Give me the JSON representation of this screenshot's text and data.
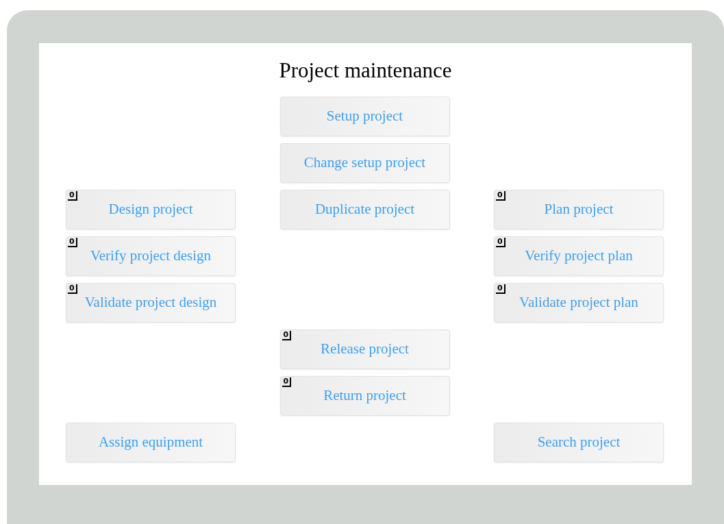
{
  "title": "Project maintenance",
  "rows": [
    {
      "center": {
        "label": "Setup project"
      }
    },
    {
      "center": {
        "label": "Change setup project"
      }
    },
    {
      "left": {
        "label": "Design project",
        "badge": "0"
      },
      "center": {
        "label": "Duplicate project"
      },
      "right": {
        "label": "Plan project",
        "badge": "0"
      }
    },
    {
      "left": {
        "label": "Verify project design",
        "badge": "0"
      },
      "right": {
        "label": "Verify project plan",
        "badge": "0"
      }
    },
    {
      "left": {
        "label": "Validate project design",
        "badge": "0"
      },
      "right": {
        "label": "Validate project plan",
        "badge": "0"
      }
    },
    {
      "center": {
        "label": "Release project",
        "badge": "0"
      }
    },
    {
      "center": {
        "label": "Return project",
        "badge": "0"
      }
    },
    {
      "left": {
        "label": "Assign equipment"
      },
      "right": {
        "label": "Search project"
      }
    }
  ]
}
